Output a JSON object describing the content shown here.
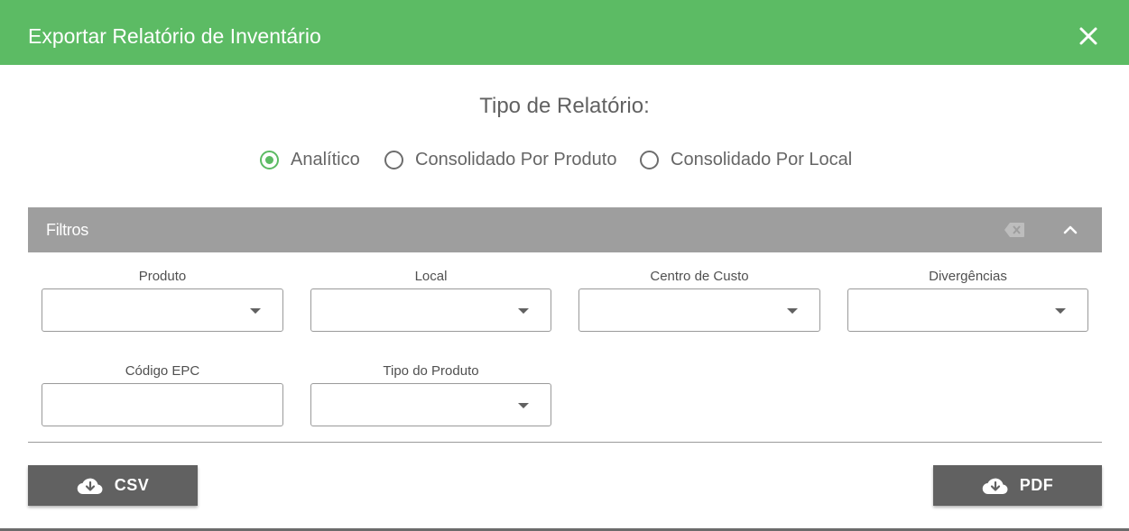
{
  "dialog": {
    "title": "Exportar Relatório de Inventário"
  },
  "report_type": {
    "label": "Tipo de Relatório:",
    "options": [
      {
        "label": "Analítico",
        "checked": true
      },
      {
        "label": "Consolidado Por Produto",
        "checked": false
      },
      {
        "label": "Consolidado Por Local",
        "checked": false
      }
    ]
  },
  "filters": {
    "title": "Filtros",
    "fields": {
      "produto": {
        "label": "Produto",
        "value": ""
      },
      "local": {
        "label": "Local",
        "value": ""
      },
      "centro_custo": {
        "label": "Centro de Custo",
        "value": ""
      },
      "divergencias": {
        "label": "Divergências",
        "value": ""
      },
      "codigo_epc": {
        "label": "Código EPC",
        "value": ""
      },
      "tipo_produto": {
        "label": "Tipo do Produto",
        "value": ""
      }
    }
  },
  "actions": {
    "csv_label": "CSV",
    "pdf_label": "PDF"
  },
  "colors": {
    "header": "#5cbb64",
    "filters_bar": "#9e9e9e",
    "button": "#616161",
    "radio_accent": "#5cbb64"
  },
  "icons": {
    "close": "close-icon",
    "clear": "backspace-icon",
    "collapse": "chevron-up-icon",
    "download": "cloud-download-icon",
    "dropdown": "caret-down-icon"
  }
}
